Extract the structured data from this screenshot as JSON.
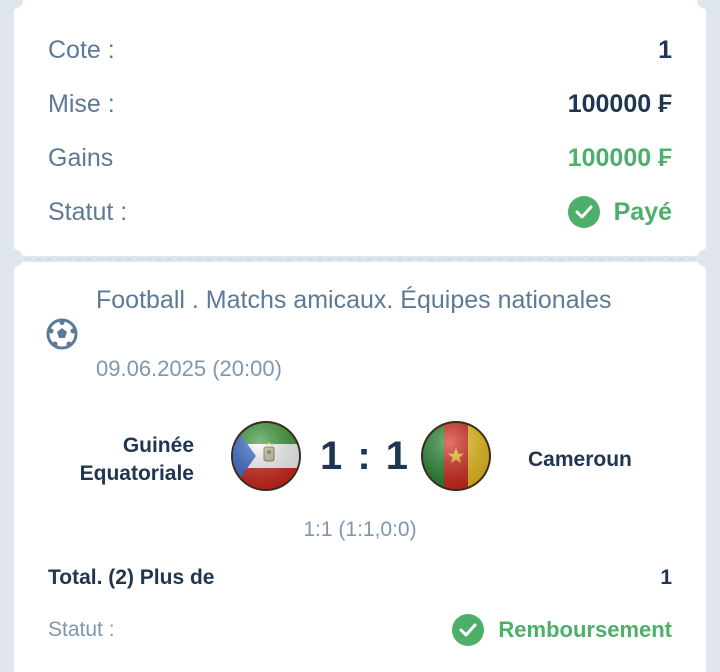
{
  "summary": {
    "odds_label": "Cote :",
    "odds_value": "1",
    "stake_label": "Mise :",
    "stake_value": "100000 ₣",
    "winnings_label": "Gains",
    "winnings_value": "100000 ₣",
    "status_label": "Statut :",
    "status_value": "Payé"
  },
  "event": {
    "title": "Football . Matchs amicaux. Équipes nationales",
    "date": "09.06.2025 (20:00)",
    "home_team_line1": "Guinée",
    "home_team_line2": "Equatoriale",
    "away_team": "Cameroun",
    "score": "1 : 1",
    "score_detail": "1:1 (1:1,0:0)"
  },
  "bet": {
    "selection": "Total. (2) Plus de",
    "selection_odds": "1",
    "status_label": "Statut :",
    "status_value": "Remboursement"
  },
  "colors": {
    "green": "#4caf6a",
    "dark": "#1f3550",
    "muted": "#5c7a97"
  },
  "icons": {
    "sport": "football-icon",
    "status": "check-circle-icon"
  }
}
